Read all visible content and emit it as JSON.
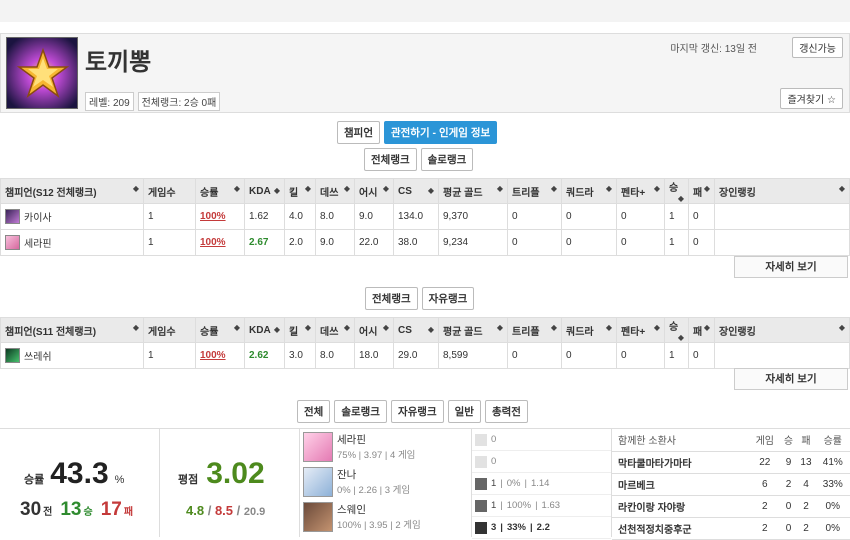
{
  "profile": {
    "name": "토끼뽕",
    "level": "레벨: 209",
    "overall_rank": "전체랭크: 2승 0패",
    "last_update": "마지막 갱신: 13일 전",
    "refresh_btn": "갱신가능",
    "favorite_btn": "즐겨찾기 ☆"
  },
  "main_tabs": [
    "챔피언",
    "관전하기 - 인게임 정보"
  ],
  "s12": {
    "tabs": [
      "전체랭크",
      "솔로랭크"
    ],
    "headers": [
      "챔피언(S12 전체랭크)",
      "게임수",
      "승률",
      "KDA",
      "킬",
      "데쓰",
      "어시",
      "CS",
      "평균 골드",
      "트리플",
      "쿼드라",
      "펜타+",
      "승",
      "패",
      "장인랭킹"
    ],
    "rows": [
      {
        "champ": "카이사",
        "games": "1",
        "wr": "100%",
        "kda": "1.62",
        "k": "4.0",
        "d": "8.0",
        "a": "9.0",
        "cs": "134.0",
        "gold": "9,370",
        "tr": "0",
        "qd": "0",
        "pk": "0",
        "w": "1",
        "l": "0",
        "rank": ""
      },
      {
        "champ": "세라핀",
        "games": "1",
        "wr": "100%",
        "kda": "2.67",
        "k": "2.0",
        "d": "9.0",
        "a": "22.0",
        "cs": "38.0",
        "gold": "9,234",
        "tr": "0",
        "qd": "0",
        "pk": "0",
        "w": "1",
        "l": "0",
        "rank": ""
      }
    ],
    "more": "자세히 보기"
  },
  "s11": {
    "tabs": [
      "전체랭크",
      "자유랭크"
    ],
    "headers": [
      "챔피언(S11 전체랭크)",
      "게임수",
      "승률",
      "KDA",
      "킬",
      "데쓰",
      "어시",
      "CS",
      "평균 골드",
      "트리플",
      "쿼드라",
      "펜타+",
      "승",
      "패",
      "장인랭킹"
    ],
    "rows": [
      {
        "champ": "쓰레쉬",
        "games": "1",
        "wr": "100%",
        "kda": "2.62",
        "k": "3.0",
        "d": "8.0",
        "a": "18.0",
        "cs": "29.0",
        "gold": "8,599",
        "tr": "0",
        "qd": "0",
        "pk": "0",
        "w": "1",
        "l": "0",
        "rank": ""
      }
    ],
    "more": "자세히 보기"
  },
  "match_tabs": [
    "전체",
    "솔로랭크",
    "자유랭크",
    "일반",
    "총력전"
  ],
  "summary": {
    "wr_label": "승률",
    "wr_value": "43.3",
    "wr_unit": "%",
    "games": "30",
    "games_unit": "전",
    "wins": "13",
    "wins_unit": "승",
    "losses": "17",
    "losses_unit": "패",
    "rating_label": "평점",
    "rating": "3.02",
    "k": "4.8",
    "d": "8.5",
    "a": "20.9"
  },
  "recent_champs": [
    {
      "name": "세라핀",
      "wr": "75%",
      "kda": "3.97",
      "games": "4 게임"
    },
    {
      "name": "잔나",
      "wr": "0%",
      "kda": "2.26",
      "games": "3 게임"
    },
    {
      "name": "스웨인",
      "wr": "100%",
      "kda": "3.95",
      "games": "2 게임"
    }
  ],
  "lanes": [
    {
      "a": "0",
      "b": "",
      "c": ""
    },
    {
      "a": "0",
      "b": "",
      "c": ""
    },
    {
      "a": "1",
      "b": "0%",
      "c": "1.14"
    },
    {
      "a": "1",
      "b": "100%",
      "c": "1.63"
    },
    {
      "a": "3",
      "b": "33%",
      "c": "2.2"
    }
  ],
  "friends": {
    "headers": [
      "함께한 소환사",
      "게임",
      "승",
      "패",
      "승률"
    ],
    "rows": [
      [
        "막타쿨마타가마타",
        "22",
        "9",
        "13",
        "41%"
      ],
      [
        "마르베크",
        "6",
        "2",
        "4",
        "33%"
      ],
      [
        "라칸이랑 자야랑",
        "2",
        "0",
        "2",
        "0%"
      ],
      [
        "선천적정치중후군",
        "2",
        "0",
        "2",
        "0%"
      ]
    ]
  },
  "colors": {
    "accent": "#2b95d7",
    "win": "#2e8b2e",
    "loss": "#c43a3a"
  }
}
